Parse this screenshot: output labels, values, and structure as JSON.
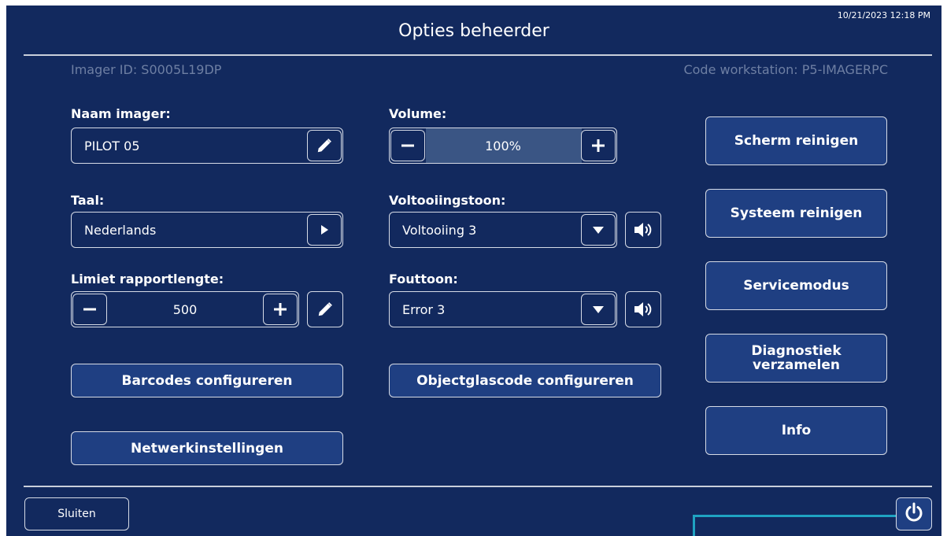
{
  "window": {
    "title": "Opties beheerder",
    "timestamp": "10/21/2023 12:18 PM"
  },
  "info": {
    "imager_id": "Imager ID: S0005L19DP",
    "workstation": "Code workstation: P5-IMAGERPC"
  },
  "name": {
    "label": "Naam imager:",
    "value": "PILOT 05",
    "icon": "pencil-icon"
  },
  "language": {
    "label": "Taal:",
    "value": "Nederlands",
    "icon": "play-right-icon"
  },
  "report_limit": {
    "label": "Limiet rapportlengte:",
    "value": "500"
  },
  "volume": {
    "label": "Volume:",
    "value": "100%",
    "level": 1.0
  },
  "completion_tone": {
    "label": "Voltooiingstoon:",
    "value": "Voltooiing 3"
  },
  "error_tone": {
    "label": "Fouttoon:",
    "value": "Error 3"
  },
  "buttons": {
    "barcodes": "Barcodes configureren",
    "network": "Netwerkinstellingen",
    "slide_code": "Objectglascode configureren",
    "clean_screen": "Scherm reinigen",
    "clean_system": "Systeem reinigen",
    "service": "Servicemodus",
    "diagnostics_1": "Diagnostiek",
    "diagnostics_2": "verzamelen",
    "info": "Info",
    "close": "Sluiten"
  },
  "colors": {
    "background": "#12295e",
    "button": "#1f3f82",
    "highlight": "#1fa3c2",
    "muted_text": "#6e7fa3"
  }
}
